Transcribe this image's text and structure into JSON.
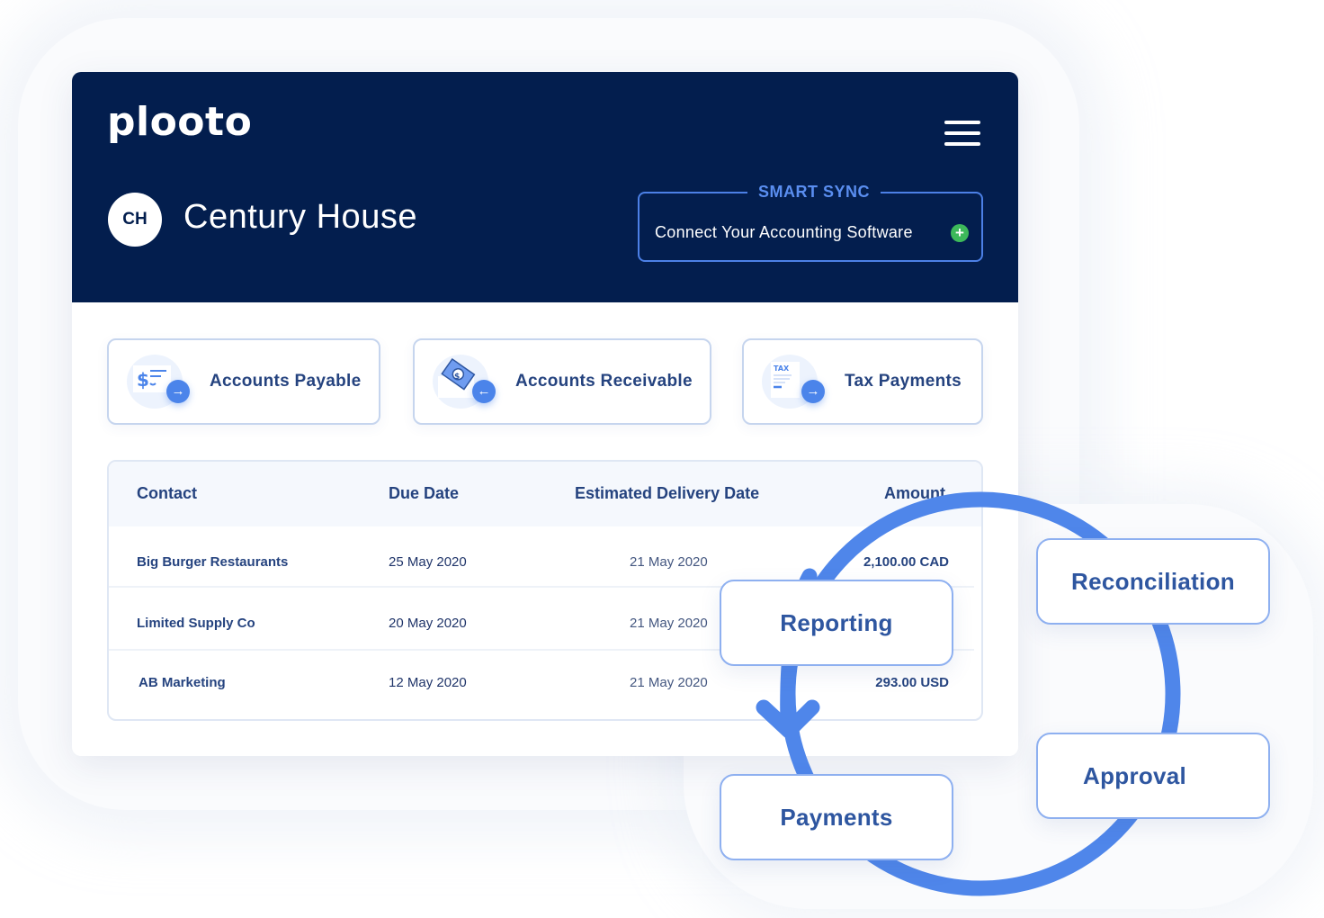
{
  "brand": {
    "logo": "plooto",
    "primary_color": "#031e4e",
    "accent_color": "#4b84ea",
    "success_color": "#3db95a"
  },
  "header": {
    "menu_icon": "hamburger-menu-icon",
    "company_initials": "CH",
    "company_name": "Century House",
    "smart_sync": {
      "title": "SMART SYNC",
      "label": "Connect Your Accounting Software",
      "icon": "plus-circle-icon"
    }
  },
  "actions": [
    {
      "label": "Accounts Payable",
      "icon": "check-dollar-icon",
      "direction_icon": "arrow-right-icon",
      "arrow": "→"
    },
    {
      "label": "Accounts Receivable",
      "icon": "money-envelope-icon",
      "direction_icon": "arrow-left-icon",
      "arrow": "←"
    },
    {
      "label": "Tax Payments",
      "icon": "tax-document-icon",
      "direction_icon": "arrow-right-icon",
      "arrow": "→",
      "icon_text": "TAX"
    }
  ],
  "table": {
    "columns": [
      "Contact",
      "Due Date",
      "Estimated Delivery Date",
      "Amount"
    ],
    "rows": [
      {
        "contact": "Big Burger Restaurants",
        "due_date": "25 May 2020",
        "estimated_delivery": "21 May 2020",
        "amount": "2,100.00 CAD"
      },
      {
        "contact": "Limited Supply Co",
        "due_date": "20 May 2020",
        "estimated_delivery": "21 May 2020",
        "amount": ""
      },
      {
        "contact": "AB Marketing",
        "due_date": "12 May 2020",
        "estimated_delivery": "21 May 2020",
        "amount": "293.00 USD"
      }
    ]
  },
  "workflow": {
    "steps": [
      "Reporting",
      "Payments",
      "Approval",
      "Reconciliation"
    ],
    "arrow_icon": "arrow-down-icon"
  }
}
